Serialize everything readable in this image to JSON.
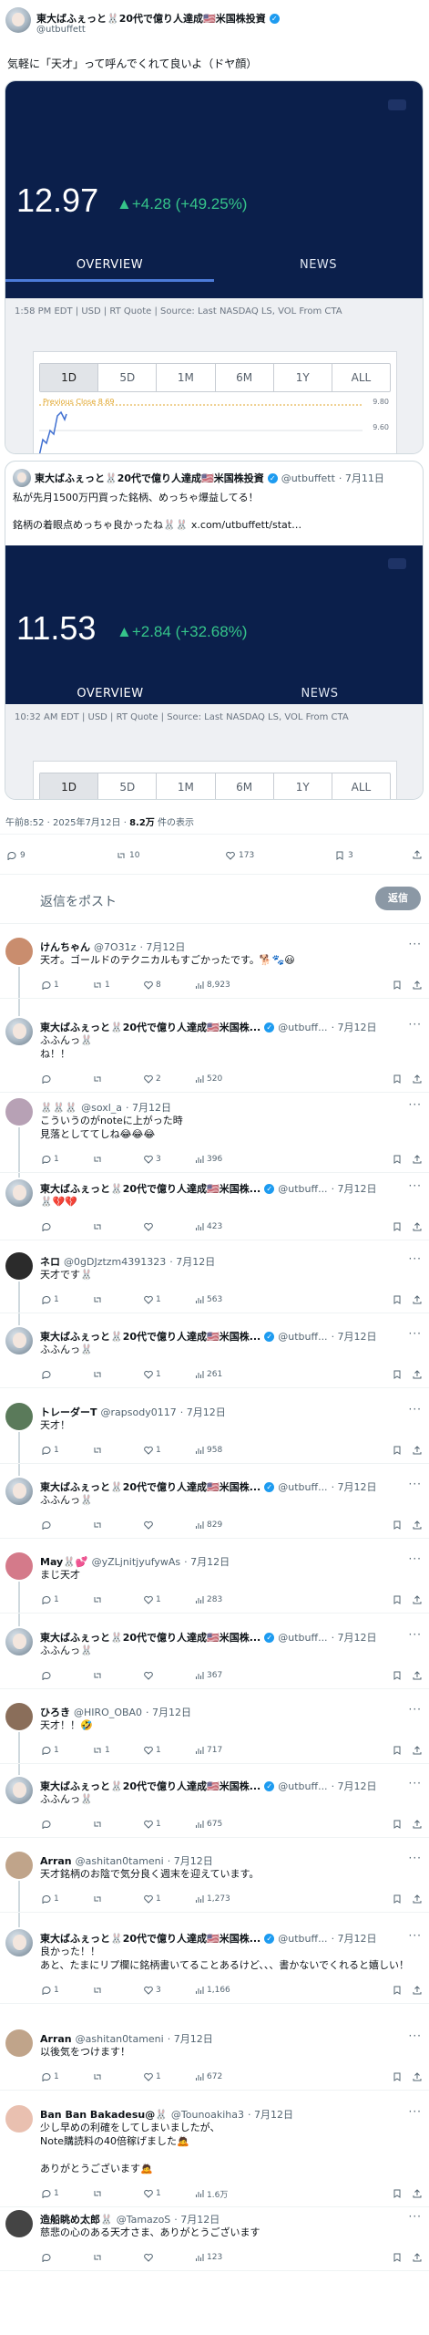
{
  "main_tweet": {
    "name": "東大ばふぇっと🐰20代で億り人達成🇺🇸米国株投資",
    "handle": "@utbuffett",
    "text": "気軽に「天才」って呼んでくれて良いよ（ドヤ顔）",
    "timestamp": "午前8:52 · 2025年7月12日 · ",
    "views_count": "8.2万",
    "views_label": " 件の表示",
    "stats": {
      "replies": "9",
      "retweets": "10",
      "likes": "173",
      "bookmarks": "3"
    }
  },
  "stock_card_1": {
    "price": "12.97",
    "change": "▲+4.28 (+49.25%)",
    "tab_overview": "OVERVIEW",
    "tab_news": "NEWS",
    "meta": "1:58 PM EDT | USD | RT Quote | Source: Last NASDAQ LS, VOL From CTA",
    "ranges": [
      "1D",
      "5D",
      "1M",
      "6M",
      "1Y",
      "ALL"
    ],
    "prev_close": "Previous Close 8.69",
    "y_top": "9.80",
    "y_bottom": "9.60"
  },
  "quoted_tweet": {
    "name": "東大ばふぇっと🐰20代で億り人達成🇺🇸米国株投資",
    "handle": "@utbuffett",
    "date": "· 7月11日",
    "line1": "私が先月1500万円買った銘柄、めっちゃ爆益してる！",
    "line2": "銘柄の着眼点めっちゃ良かったね🐰🐰 x.com/utbuffett/stat…"
  },
  "stock_card_2": {
    "price": "11.53",
    "change": "▲+2.84 (+32.68%)",
    "tab_overview": "OVERVIEW",
    "tab_news": "NEWS",
    "meta": "10:32 AM EDT | USD | RT Quote | Source: Last NASDAQ LS, VOL From CTA",
    "ranges": [
      "1D",
      "5D",
      "1M",
      "6M",
      "1Y",
      "ALL"
    ]
  },
  "reply_box": {
    "placeholder": "返信をポスト",
    "button": "返信"
  },
  "replies": [
    {
      "name": "けんちゃん",
      "handle": "@7O31z",
      "date": "· 7月12日",
      "text": "天才。ゴールドのテクニカルもすごかったです。🐕🐾😃",
      "reply": "1",
      "rt": "1",
      "like": "8",
      "views": "8,923"
    },
    {
      "name": "東大ばふぇっと🐰20代で億り人達成🇺🇸米国株...",
      "handle": "@utbuff...",
      "date": "· 7月12日",
      "text": "ふふんっ🐰\nね！！",
      "reply": "",
      "rt": "",
      "like": "2",
      "views": "520"
    },
    {
      "name": "🐰🐰🐰",
      "handle": "@soxl_a",
      "date": "· 7月12日",
      "text": "こういうのがnoteに上がった時\n見落としててしね😂😂😂",
      "reply": "1",
      "rt": "",
      "like": "3",
      "views": "396"
    },
    {
      "name": "東大ばふぇっと🐰20代で億り人達成🇺🇸米国株...",
      "handle": "@utbuff...",
      "date": "· 7月12日",
      "text": "🐰💔💔",
      "reply": "",
      "rt": "",
      "like": "",
      "views": "423"
    },
    {
      "name": "ネロ",
      "handle": "@0gDJztzm4391323",
      "date": "· 7月12日",
      "text": "天才です🐰",
      "reply": "1",
      "rt": "",
      "like": "1",
      "views": "563"
    },
    {
      "name": "東大ばふぇっと🐰20代で億り人達成🇺🇸米国株...",
      "handle": "@utbuff...",
      "date": "· 7月12日",
      "text": "ふふんっ🐰",
      "reply": "",
      "rt": "",
      "like": "1",
      "views": "261"
    },
    {
      "name": "トレーダーT",
      "handle": "@rapsody0117",
      "date": "· 7月12日",
      "text": "天才！",
      "reply": "1",
      "rt": "",
      "like": "1",
      "views": "958"
    },
    {
      "name": "東大ばふぇっと🐰20代で億り人達成🇺🇸米国株...",
      "handle": "@utbuff...",
      "date": "· 7月12日",
      "text": "ふふんっ🐰",
      "reply": "",
      "rt": "",
      "like": "",
      "views": "829"
    },
    {
      "name": "May🐰💕",
      "handle": "@yZLjnitjyufywAs",
      "date": "· 7月12日",
      "text": "まじ天才",
      "reply": "1",
      "rt": "",
      "like": "1",
      "views": "283"
    },
    {
      "name": "東大ばふぇっと🐰20代で億り人達成🇺🇸米国株...",
      "handle": "@utbuff...",
      "date": "· 7月12日",
      "text": "ふふんっ🐰",
      "reply": "",
      "rt": "",
      "like": "",
      "views": "367"
    },
    {
      "name": "ひろき",
      "handle": "@HIRO_OBA0",
      "date": "· 7月12日",
      "text": "天才！！🤣",
      "reply": "1",
      "rt": "1",
      "like": "1",
      "views": "717"
    },
    {
      "name": "東大ばふぇっと🐰20代で億り人達成🇺🇸米国株...",
      "handle": "@utbuff...",
      "date": "· 7月12日",
      "text": "ふふんっ🐰",
      "reply": "",
      "rt": "",
      "like": "1",
      "views": "675"
    },
    {
      "name": "Arran",
      "handle": "@ashitan0tameni",
      "date": "· 7月12日",
      "text": "天才銘柄のお陰で気分良く週末を迎えています。",
      "reply": "1",
      "rt": "",
      "like": "1",
      "views": "1,273"
    },
    {
      "name": "東大ばふぇっと🐰20代で億り人達成🇺🇸米国株...",
      "handle": "@utbuff...",
      "date": "· 7月12日",
      "text": "良かった！！\nあと、たまにリプ欄に銘柄書いてることあるけど、、、書かないでくれると嬉しい！",
      "reply": "1",
      "rt": "",
      "like": "3",
      "views": "1,166"
    },
    {
      "name": "Arran",
      "handle": "@ashitan0tameni",
      "date": "· 7月12日",
      "text": "以後気をつけます！",
      "reply": "1",
      "rt": "",
      "like": "1",
      "views": "672"
    },
    {
      "name": "Ban Ban Bakadesu@🐰",
      "handle": "@Tounoakiha3",
      "date": "· 7月12日",
      "text": "少し早めの利確をしてしまいましたが、\nNote購読料の40倍稼げました🙇\n\nありがとうございます🙇",
      "reply": "1",
      "rt": "",
      "like": "1",
      "views": "1.6万"
    },
    {
      "name": "造船眺め太郎🐰",
      "handle": "@TamazoS",
      "date": "· 7月12日",
      "text": "慈悲の心のある天才さま、ありがとうございます",
      "reply": "",
      "rt": "",
      "like": "",
      "views": "123"
    }
  ]
}
